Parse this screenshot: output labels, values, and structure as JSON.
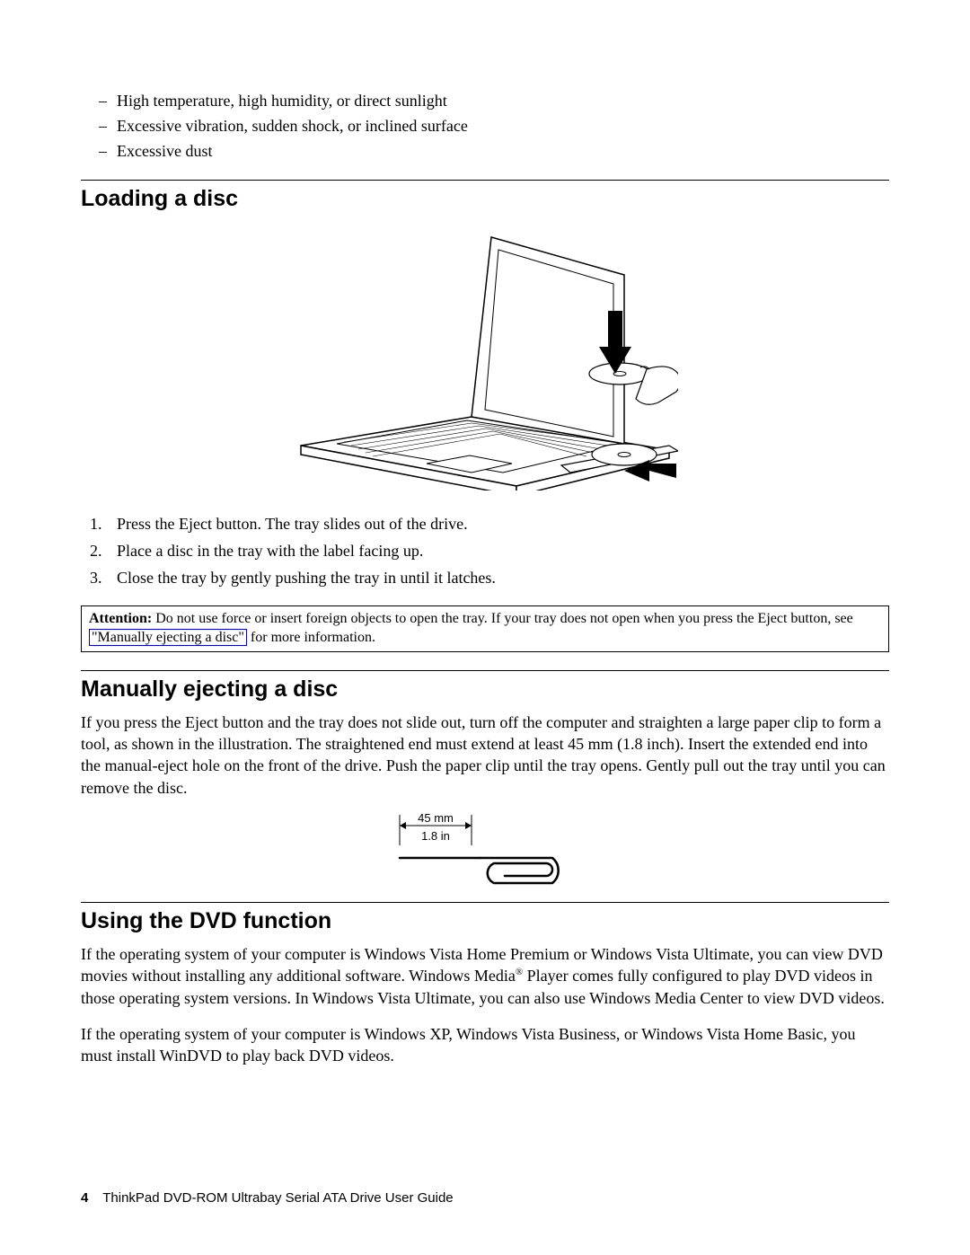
{
  "bullets": {
    "b1": "High temperature, high humidity, or direct sunlight",
    "b2": "Excessive vibration, sudden shock, or inclined surface",
    "b3": "Excessive dust"
  },
  "sections": {
    "loading": "Loading a disc",
    "manual": "Manually ejecting a disc",
    "dvd": "Using the DVD function"
  },
  "steps": {
    "s1": "Press the Eject button. The tray slides out of the drive.",
    "s2": "Place a disc in the tray with the label facing up.",
    "s3": "Close the tray by gently pushing the tray in until it latches."
  },
  "attention": {
    "label": "Attention:",
    "before": " Do not use force or insert foreign objects to open the tray. If your tray does not open when you press the Eject button, see ",
    "link": "\"Manually ejecting a disc\"",
    "after": " for more information."
  },
  "manual_para": "If you press the Eject button and the tray does not slide out, turn off the computer and straighten a large paper clip to form a tool, as shown in the illustration. The straightened end must extend at least 45 mm (1.8 inch). Insert the extended end into the manual-eject hole on the front of the drive. Push the paper clip until the tray opens. Gently pull out the tray until you can remove the disc.",
  "clip_labels": {
    "mm": "45 mm",
    "in": "1.8 in"
  },
  "dvd_para1_a": "If the operating system of your computer is Windows Vista Home Premium or Windows Vista Ultimate, you can view DVD movies without installing any additional software. Windows Media",
  "dvd_para1_b": " Player comes fully configured to play DVD videos in those operating system versions. In Windows Vista Ultimate, you can also use Windows Media Center to view DVD videos.",
  "dvd_para2": "If the operating system of your computer is Windows XP, Windows Vista Business, or Windows Vista Home Basic, you must install WinDVD to play back DVD videos.",
  "footer": {
    "page": "4",
    "title": "ThinkPad DVD-ROM Ultrabay Serial ATA Drive User Guide"
  }
}
